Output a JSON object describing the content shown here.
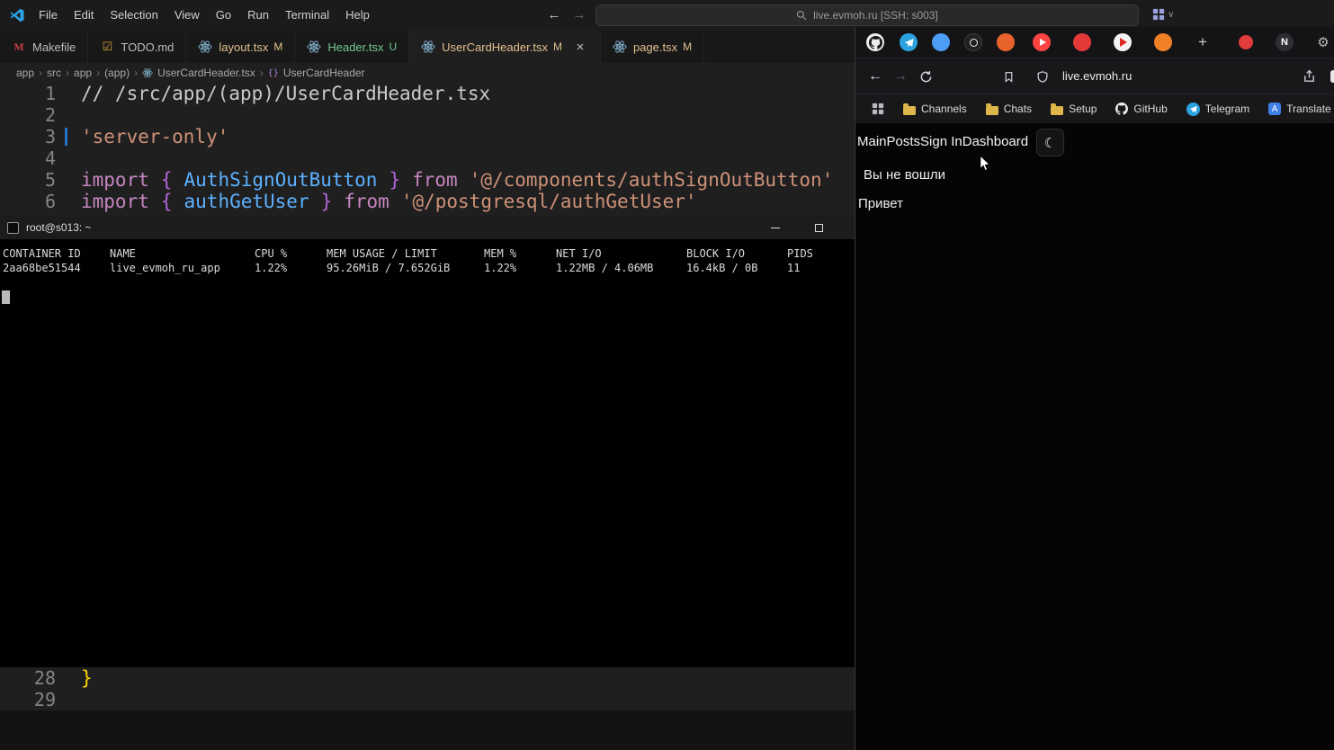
{
  "colors": {
    "git_modified": "#e2c08d",
    "git_untracked": "#73c991",
    "accent_blue": "#2472c8"
  },
  "icons": {
    "back": "←",
    "forward": "→",
    "moon": "☾",
    "gear": "⚙",
    "todo": "☑",
    "menu_chevron": "∨",
    "breadcrumb_sep": "›",
    "close": "×",
    "makefile": "M",
    "symbol_braces": "{}"
  },
  "titlebar": {
    "menu": [
      "File",
      "Edit",
      "Selection",
      "View",
      "Go",
      "Run",
      "Terminal",
      "Help"
    ],
    "search_text": "live.evmoh.ru [SSH: s003]"
  },
  "tabs": [
    {
      "label": "Makefile",
      "badge": ""
    },
    {
      "label": "TODO.md",
      "badge": ""
    },
    {
      "label": "layout.tsx",
      "badge": "M"
    },
    {
      "label": "Header.tsx",
      "badge": "U"
    },
    {
      "label": "UserCardHeader.tsx",
      "badge": "M"
    },
    {
      "label": "page.tsx",
      "badge": "M"
    }
  ],
  "breadcrumb": [
    "app",
    "src",
    "app",
    "(app)",
    "UserCardHeader.tsx",
    "UserCardHeader"
  ],
  "code": {
    "line_numbers_top": [
      "1",
      "2",
      "3",
      "4",
      "5",
      "6"
    ],
    "line_numbers_bottom": [
      "28",
      "29"
    ],
    "comment": "// /src/app/(app)/UserCardHeader.tsx",
    "directive": "'server-only'",
    "import1": {
      "kw": "import",
      "open": "{",
      "name": "AuthSignOutButton",
      "close": "}",
      "from": "from",
      "path": "'@/components/authSignOutButton'"
    },
    "import2": {
      "kw": "import",
      "open": "{",
      "name": "authGetUser",
      "close": "}",
      "from": "from",
      "path": "'@/postgresql/authGetUser'"
    },
    "closing_brace": "}"
  },
  "terminal": {
    "title": "root@s013: ~",
    "headers": [
      "CONTAINER ID",
      "NAME",
      "CPU %",
      "MEM USAGE / LIMIT",
      "MEM %",
      "NET I/O",
      "BLOCK I/O",
      "PIDS"
    ],
    "row": [
      "2aa68be51544",
      "live_evmoh_ru_app",
      "1.22%",
      "95.26MiB / 7.652GiB",
      "1.22%",
      "1.22MB / 4.06MB",
      "16.4kB / 0B",
      "11"
    ]
  },
  "browser": {
    "url": "live.evmoh.ru",
    "bookmarks": [
      "Channels",
      "Chats",
      "Setup",
      "GitHub",
      "Telegram",
      "Translate"
    ],
    "pinned_glyphs": {
      "plus": "+",
      "notion": "N"
    },
    "page": {
      "nav": [
        "Main",
        "Posts",
        "Sign In",
        "Dashboard"
      ],
      "login_status": "Вы не вошли",
      "greeting": "Привет"
    }
  }
}
